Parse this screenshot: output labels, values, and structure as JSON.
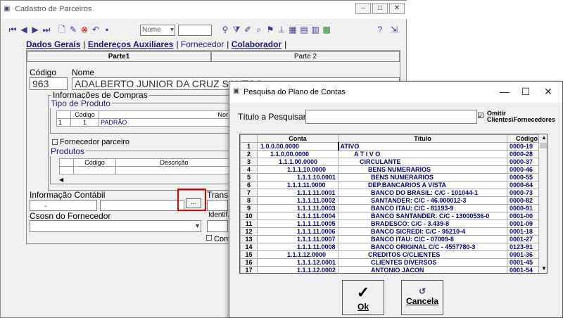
{
  "bg": {
    "title": "Cadastro de Parceiros",
    "toolbar": {
      "select1": "Nome",
      "select2": ""
    },
    "tabs": [
      "Dados Gerais",
      "Endereços Auxiliares",
      "Fornecedor",
      "Colaborador"
    ],
    "subtabs": [
      "Parte1",
      "Parte 2"
    ],
    "codigo_label": "Código",
    "codigo_value": "963",
    "nome_label": "Nome",
    "nome_value": "ADALBERTO JUNIOR DA CRUZ SANTOS",
    "info_compras": "Informações de Compras",
    "tipo_produto": "Tipo de Produto",
    "tp_headers": [
      "Código",
      "Nor"
    ],
    "tp_row": {
      "num": "1",
      "code": "1",
      "desc": "PADRÃO"
    },
    "fornecedor_parceiro": "Fornecedor parceiro",
    "produtos": "Produtos",
    "prod_headers": [
      "Código",
      "Descrição"
    ],
    "info_contabil": "Informação Contábil",
    "info_contabil_value": "-",
    "transp": "Transp",
    "dots": "...",
    "csosn": "Csosn do Fornecedor",
    "identif": "Identif.",
    "cont": "Cont"
  },
  "dlg": {
    "title": "Pesquisa do Plano de Contas",
    "search_label": "Título a Pesquisar",
    "search_value": "",
    "omit_line1": "Omitir",
    "omit_line2": "Clientes\\Fornecedores",
    "omit_checked": true,
    "headers": [
      "Conta",
      "Título",
      "Código"
    ],
    "rows": [
      {
        "n": "1",
        "conta": "1.0.0.00.0000",
        "titulo": "ATIVO",
        "cod": "0000-19",
        "ci": 0,
        "ti": 0
      },
      {
        "n": "2",
        "conta": "1.1.0.00.0000",
        "titulo": "A T I V O",
        "cod": "0000-28",
        "ci": 1,
        "ti": 1
      },
      {
        "n": "3",
        "conta": "1.1.1.00.0000",
        "titulo": "CIRCULANTE",
        "cod": "0000-37",
        "ci": 2,
        "ti": 2
      },
      {
        "n": "4",
        "conta": "1.1.1.10.0000",
        "titulo": "BENS NUMERARIOS",
        "cod": "0000-46",
        "ci": 3,
        "ti": 3
      },
      {
        "n": "5",
        "conta": "1.1.1.10.0001",
        "titulo": "BENS NUMERARIOS",
        "cod": "0000-55",
        "ci": 4,
        "ti": 4
      },
      {
        "n": "6",
        "conta": "1.1.1.11.0000",
        "titulo": "DEP.BANCARIOS A VISTA",
        "cod": "0000-64",
        "ci": 3,
        "ti": 3
      },
      {
        "n": "7",
        "conta": "1.1.1.11.0001",
        "titulo": "BANCO DO BRASIL: C/C - 101044-1",
        "cod": "0000-73",
        "ci": 4,
        "ti": 4
      },
      {
        "n": "8",
        "conta": "1.1.1.11.0002",
        "titulo": "SANTANDER: C/C - 46.000012-3",
        "cod": "0000-82",
        "ci": 4,
        "ti": 4
      },
      {
        "n": "9",
        "conta": "1.1.1.11.0003",
        "titulo": "BANCO ITAU: C/C - 81193-9",
        "cod": "0000-91",
        "ci": 4,
        "ti": 4
      },
      {
        "n": "10",
        "conta": "1.1.1.11.0004",
        "titulo": "BANCO SANTANDER: C/C - 13000536-0",
        "cod": "0001-00",
        "ci": 4,
        "ti": 4
      },
      {
        "n": "11",
        "conta": "1.1.1.11.0005",
        "titulo": "BRADESCO: C/C - 3.439-8",
        "cod": "0001-09",
        "ci": 4,
        "ti": 4
      },
      {
        "n": "12",
        "conta": "1.1.1.11.0006",
        "titulo": "BANCO SICREDI: C/C - 95210-4",
        "cod": "0001-18",
        "ci": 4,
        "ti": 4
      },
      {
        "n": "13",
        "conta": "1.1.1.11.0007",
        "titulo": "BANCO ITAU: C/C - 07009-8",
        "cod": "0001-27",
        "ci": 4,
        "ti": 4
      },
      {
        "n": "14",
        "conta": "1.1.1.11.0008",
        "titulo": "BANCO ORIGINAL C/C - 4557780-3",
        "cod": "0123-91",
        "ci": 4,
        "ti": 4
      },
      {
        "n": "15",
        "conta": "1.1.1.12.0000",
        "titulo": "CREDITOS C/CLIENTES",
        "cod": "0001-36",
        "ci": 3,
        "ti": 3
      },
      {
        "n": "16",
        "conta": "1.1.1.12.0001",
        "titulo": "CLIENTES DIVERSOS",
        "cod": "0001-45",
        "ci": 4,
        "ti": 4
      },
      {
        "n": "17",
        "conta": "1.1.1.12.0002",
        "titulo": "ANTONIO JACON",
        "cod": "0001-54",
        "ci": 4,
        "ti": 4
      }
    ],
    "ok_label": "Ok",
    "cancel_label": "Cancela"
  },
  "colors": {
    "highlight": "#e00000",
    "grid_text": "#00007a"
  }
}
